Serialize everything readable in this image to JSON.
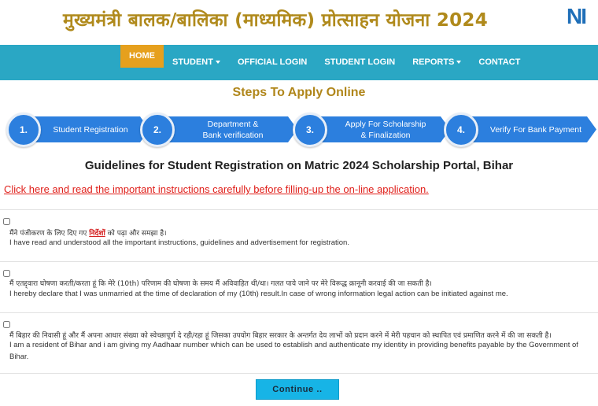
{
  "header": {
    "title": "मुख्यमंत्री बालक/बालिका (माध्यमिक) प्रोत्साहन योजना 2024",
    "logo_text": "NI"
  },
  "nav": {
    "items": [
      {
        "label": "HOME",
        "active": true,
        "dropdown": false
      },
      {
        "label": "STUDENT",
        "active": false,
        "dropdown": true
      },
      {
        "label": "OFFICIAL LOGIN",
        "active": false,
        "dropdown": false
      },
      {
        "label": "STUDENT LOGIN",
        "active": false,
        "dropdown": false
      },
      {
        "label": "REPORTS",
        "active": false,
        "dropdown": true
      },
      {
        "label": "CONTACT",
        "active": false,
        "dropdown": false
      }
    ]
  },
  "steps": {
    "title": "Steps To Apply Online",
    "items": [
      {
        "number": "1.",
        "line1": "Student Registration",
        "line2": ""
      },
      {
        "number": "2.",
        "line1": "Department &",
        "line2": "Bank verification"
      },
      {
        "number": "3.",
        "line1": "Apply For Scholarship",
        "line2": "& Finalization"
      },
      {
        "number": "4.",
        "line1": "Verify For Bank Payment",
        "line2": ""
      }
    ]
  },
  "guidelines": {
    "title": "Guidelines for Student Registration on Matric 2024 Scholarship Portal, Bihar",
    "instruction_link": "Click here and read the important instructions carefully before filling-up the on-line application."
  },
  "declarations": [
    {
      "hindi_before": "मैंने पंजीकरण के लिए दिए गए ",
      "hindi_link": "निर्देशों",
      "hindi_after": " को पढ़ा और समझा है।",
      "english": "I have read and understood all the important instructions, guidelines and advertisement for registration."
    },
    {
      "hindi_before": "मैं एतद्द्वारा घोषणा करती/करता हूं कि मेरे (10th) परिणाम की घोषणा के समय मैं अविवाहित थी/था। गलत पाये जाने पर मेरे विरूद्ध क़ानूनी करवाई की जा सकती है।",
      "hindi_link": "",
      "hindi_after": "",
      "english": "I hereby declare that I was unmarried at the time of declaration of my (10th) result.In case of wrong information legal action can be initiated against me."
    },
    {
      "hindi_before": "मैं बिहार की निवासी हूं और मैं अपना आधार संख्या को स्वेच्छापूर्ण दे रही/रहा हूं जिसका उपयोग बिहार सरकार के अन्तर्गत देय लाभों को प्रदान करने में मेरी पहचान को स्थापित एवं प्रमाणित करने में की जा सकती है।",
      "hindi_link": "",
      "hindi_after": "",
      "english": "I am a resident of Bihar and i am giving my Aadhaar number which can be used to establish and authenticate my identity in providing benefits payable by the Government of Bihar."
    }
  ],
  "continue_label": "Continue ..",
  "colors": {
    "title_gold": "#b08a1c",
    "nav_teal": "#2aa7c4",
    "nav_active": "#e6a01d",
    "step_blue": "#2c7fde",
    "link_red": "#e0201b",
    "button_cyan": "#17b4e6"
  }
}
